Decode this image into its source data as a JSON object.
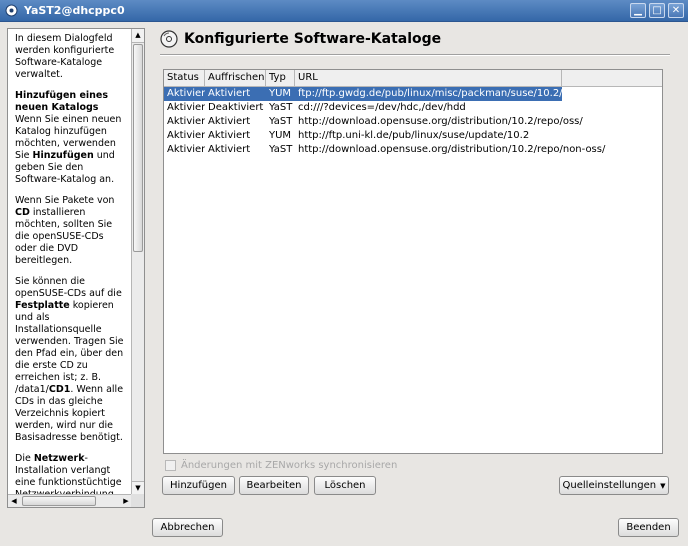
{
  "window": {
    "title": "YaST2@dhcppc0",
    "controls": [
      "minimize",
      "maximize",
      "close"
    ]
  },
  "help": {
    "paragraphs": [
      [
        {
          "t": "In diesem Dialogfeld werden konfigurierte Software-Kataloge verwaltet."
        }
      ],
      [
        {
          "t": "Hinzufügen eines neuen Katalogs",
          "b": true
        },
        {
          "t": " Wenn Sie einen neuen Katalog hinzufügen möchten, verwenden Sie "
        },
        {
          "t": "Hinzufügen",
          "b": true
        },
        {
          "t": " und geben Sie den Software-Katalog an."
        }
      ],
      [
        {
          "t": "Wenn Sie Pakete von "
        },
        {
          "t": "CD",
          "b": true
        },
        {
          "t": " installieren möchten, sollten Sie die openSUSE-CDs oder die DVD bereitlegen."
        }
      ],
      [
        {
          "t": "Sie können die openSUSE-CDs auf die "
        },
        {
          "t": "Festplatte",
          "b": true
        },
        {
          "t": " kopieren und als Installationsquelle verwenden. Tragen Sie den Pfad ein, über den die erste CD zu erreichen ist; z. B. /data1/"
        },
        {
          "t": "CD1",
          "b": true
        },
        {
          "t": ". Wenn alle CDs in das gleiche Verzeichnis kopiert werden, wird nur die Basisadresse benötigt."
        }
      ],
      [
        {
          "t": "Die "
        },
        {
          "t": "Netzwerk",
          "b": true
        },
        {
          "t": "-Installation verlangt eine funktionstüchtige Netzwerkverbindung."
        }
      ]
    ]
  },
  "heading": "Konfigurierte Software-Kataloge",
  "table": {
    "columns": [
      "Status",
      "Auffrischen",
      "Typ",
      "URL"
    ],
    "rows": [
      [
        "Aktiviert",
        "Aktiviert",
        "YUM",
        "ftp://ftp.gwdg.de/pub/linux/misc/packman/suse/10.2/"
      ],
      [
        "Aktiviert",
        "Deaktiviert",
        "YaST",
        "cd:///?devices=/dev/hdc,/dev/hdd"
      ],
      [
        "Aktiviert",
        "Aktiviert",
        "YaST",
        "http://download.opensuse.org/distribution/10.2/repo/oss/"
      ],
      [
        "Aktiviert",
        "Aktiviert",
        "YUM",
        "http://ftp.uni-kl.de/pub/linux/suse/update/10.2"
      ],
      [
        "Aktiviert",
        "Aktiviert",
        "YaST",
        "http://download.opensuse.org/distribution/10.2/repo/non-oss/"
      ]
    ],
    "selected_row": 0
  },
  "zenworks_checkbox": {
    "label": "Änderungen mit ZENworks synchronisieren",
    "checked": false,
    "enabled": false
  },
  "buttons": {
    "add": "Hinzufügen",
    "edit": "Bearbeiten",
    "delete": "Löschen",
    "source_settings": "Quelleinstellungen",
    "cancel": "Abbrechen",
    "finish": "Beenden"
  },
  "colors": {
    "titlebar": "#3b6eb3",
    "selection": "#3b6eb3",
    "background": "#e8e6e3"
  }
}
